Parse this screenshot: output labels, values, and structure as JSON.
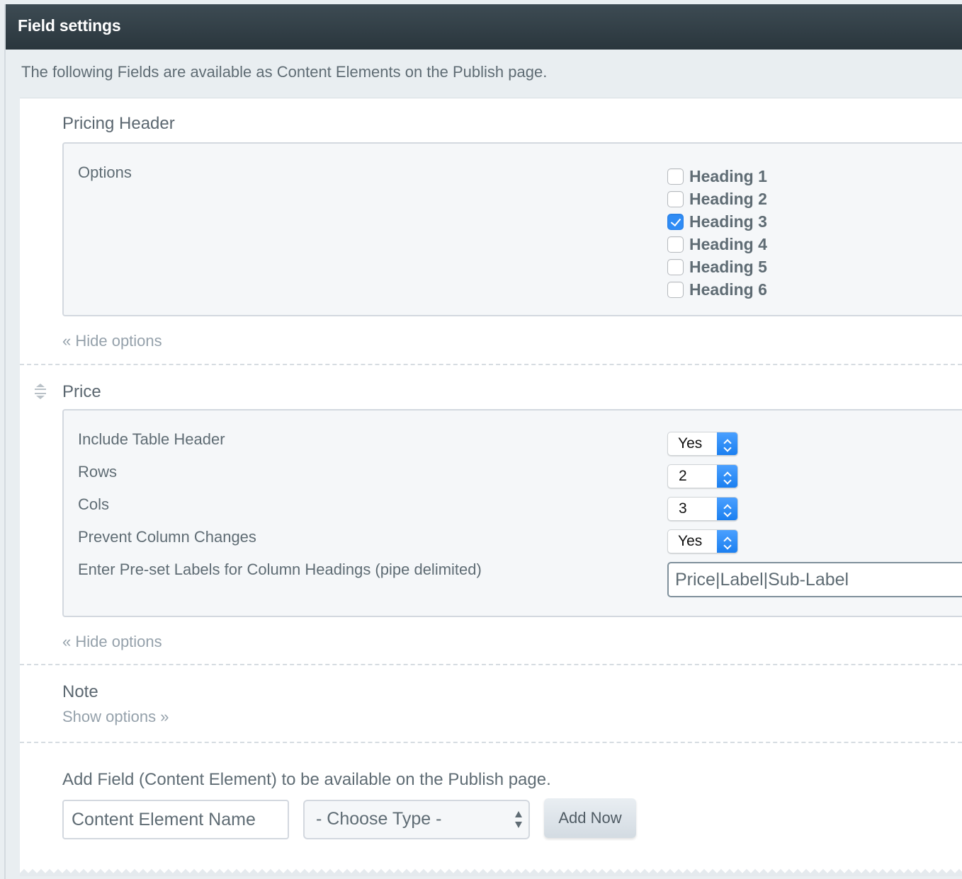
{
  "header": {
    "title": "Field settings"
  },
  "intro": "The following Fields are available as Content Elements on the Publish page.",
  "fields": [
    {
      "name": "Pricing Header",
      "options_label": "Options",
      "toggle_label": "« Hide options",
      "checkboxes": [
        {
          "label": "Heading 1",
          "checked": false
        },
        {
          "label": "Heading 2",
          "checked": false
        },
        {
          "label": "Heading 3",
          "checked": true
        },
        {
          "label": "Heading 4",
          "checked": false
        },
        {
          "label": "Heading 5",
          "checked": false
        },
        {
          "label": "Heading 6",
          "checked": false
        }
      ]
    },
    {
      "name": "Price",
      "toggle_label": "« Hide options",
      "settings": [
        {
          "label": "Include Table Header",
          "value": "Yes"
        },
        {
          "label": "Rows",
          "value": "2"
        },
        {
          "label": "Cols",
          "value": "3"
        },
        {
          "label": "Prevent Column Changes",
          "value": "Yes"
        },
        {
          "label": "Enter Pre-set Labels for Column Headings (pipe delimited)",
          "value": "Price|Label|Sub-Label"
        }
      ]
    },
    {
      "name": "Note",
      "toggle_label": "Show options »"
    }
  ],
  "add_field": {
    "title": "Add Field (Content Element) to be available on the Publish page.",
    "name_placeholder": "Content Element Name",
    "type_selected": "- Choose Type -",
    "button_label": "Add Now"
  },
  "colors": {
    "header_bg": "#2f3c43",
    "checkbox_checked": "#2f8cf5",
    "select_arrow": "#1b7ff0",
    "link": "#95a1ab"
  }
}
